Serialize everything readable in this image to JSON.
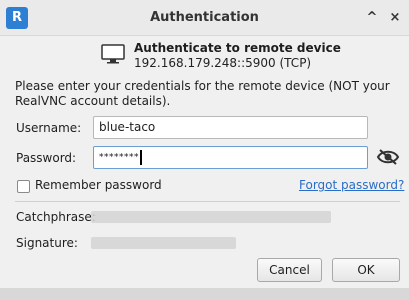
{
  "window": {
    "logo_text": "R",
    "title": "Authentication",
    "collapse_glyph": "^",
    "close_glyph": "×"
  },
  "header": {
    "icon": "monitor-icon",
    "heading": "Authenticate to remote device",
    "address": "192.168.179.248::5900 (TCP)"
  },
  "instructions": "Please enter your credentials for the remote device (NOT your RealVNC account details).",
  "form": {
    "username_label": "Username:",
    "username_value": "blue-taco",
    "password_label": "Password:",
    "password_masked": "********",
    "visibility_icon": "eye-slash-icon",
    "remember_label": "Remember password",
    "remember_checked": false,
    "forgot_link": "Forgot password?"
  },
  "verification": {
    "catchphrase_label": "Catchphrase:",
    "signature_label": "Signature:"
  },
  "buttons": {
    "cancel": "Cancel",
    "ok": "OK"
  },
  "colors": {
    "link": "#2a6dc8",
    "logo": "#2d7fd3",
    "focus_border": "#6a9ed6"
  }
}
